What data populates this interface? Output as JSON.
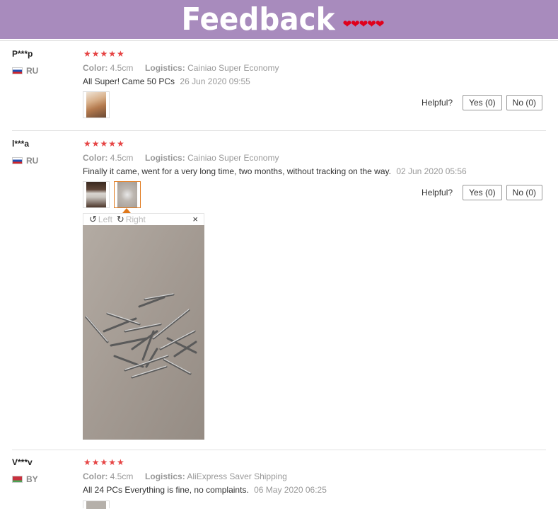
{
  "banner": {
    "title": "Feedback",
    "hearts": "❤❤❤❤❤"
  },
  "reviews": [
    {
      "user": "P***p",
      "country": "RU",
      "flag": "flag-ru",
      "stars": "★★★★★",
      "color_label": "Color:",
      "color_value": "4.5cm",
      "logistics_label": "Logistics:",
      "logistics_value": "Cainiao Super Economy",
      "text": "All Super! Came 50 PCs",
      "date": "26 Jun 2020 09:55",
      "helpful": "Helpful?",
      "yes": "Yes (0)",
      "no": "No (0)"
    },
    {
      "user": "l***a",
      "country": "RU",
      "flag": "flag-ru",
      "stars": "★★★★★",
      "color_label": "Color:",
      "color_value": "4.5cm",
      "logistics_label": "Logistics:",
      "logistics_value": "Cainiao Super Economy",
      "text": "Finally it came, went for a very long time, two months, without tracking on the way.",
      "date": "02 Jun 2020 05:56",
      "helpful": "Helpful?",
      "yes": "Yes (0)",
      "no": "No (0)"
    },
    {
      "user": "V***v",
      "country": "BY",
      "flag": "flag-by",
      "stars": "★★★★★",
      "color_label": "Color:",
      "color_value": "4.5cm",
      "logistics_label": "Logistics:",
      "logistics_value": "AliExpress Saver Shipping",
      "text": "All 24 PCs Everything is fine, no complaints.",
      "date": "06 May 2020 06:25"
    }
  ],
  "viewer": {
    "rotate_left": "Left",
    "rotate_right": "Right",
    "close": "×",
    "rotate_left_icon": "↺",
    "rotate_right_icon": "↻"
  }
}
